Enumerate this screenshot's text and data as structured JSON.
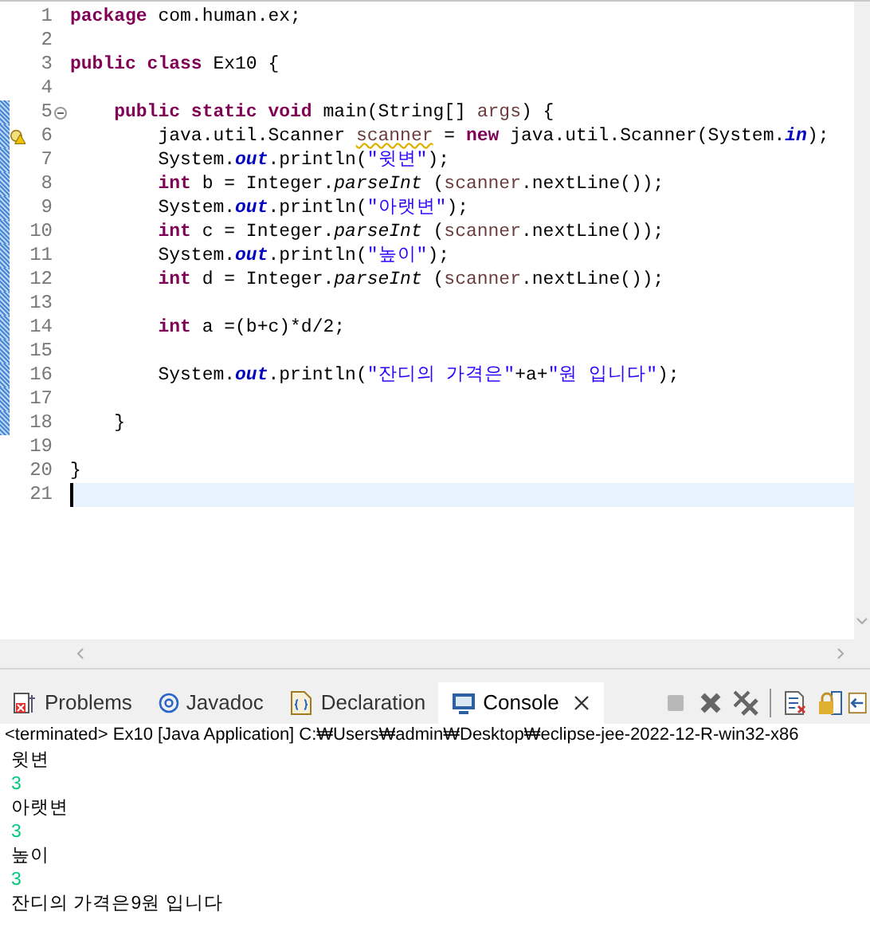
{
  "editor": {
    "lines": [
      {
        "number": "1",
        "changed": false,
        "fold": false,
        "warning": false,
        "current": false,
        "tokens": [
          {
            "kind": "kw",
            "text": "package"
          },
          {
            "kind": "plain",
            "text": " com.human.ex;"
          }
        ]
      },
      {
        "number": "2",
        "changed": false,
        "fold": false,
        "warning": false,
        "current": false
      },
      {
        "number": "3",
        "changed": false,
        "fold": false,
        "warning": false,
        "current": false,
        "tokens": [
          {
            "kind": "kw",
            "text": "public class"
          },
          {
            "kind": "plain",
            "text": " Ex10 {"
          }
        ]
      },
      {
        "number": "4",
        "changed": false,
        "fold": false,
        "warning": false,
        "current": false
      },
      {
        "number": "5",
        "changed": true,
        "fold": true,
        "warning": false,
        "current": false,
        "tokens": [
          {
            "kind": "kw",
            "text": "    public static void"
          },
          {
            "kind": "plain",
            "text": " main(String[] "
          },
          {
            "kind": "local",
            "text": "args"
          },
          {
            "kind": "plain",
            "text": ") {"
          }
        ]
      },
      {
        "number": "6",
        "changed": true,
        "fold": false,
        "warning": true,
        "current": false,
        "tokens": [
          {
            "kind": "plain",
            "text": "        java.util.Scanner "
          },
          {
            "kind": "warnlocal",
            "text": "scanner"
          },
          {
            "kind": "plain",
            "text": " = "
          },
          {
            "kind": "kw",
            "text": "new"
          },
          {
            "kind": "plain",
            "text": " java.util.Scanner(System."
          },
          {
            "kind": "field",
            "text": "in"
          },
          {
            "kind": "plain",
            "text": ");"
          }
        ]
      },
      {
        "number": "7",
        "changed": true,
        "fold": false,
        "warning": false,
        "current": false,
        "tokens": [
          {
            "kind": "plain",
            "text": "        System."
          },
          {
            "kind": "field",
            "text": "out"
          },
          {
            "kind": "plain",
            "text": ".println("
          },
          {
            "kind": "str",
            "text": "\"윗변\""
          },
          {
            "kind": "plain",
            "text": ");"
          }
        ]
      },
      {
        "number": "8",
        "changed": true,
        "fold": false,
        "warning": false,
        "current": false,
        "tokens": [
          {
            "kind": "kw",
            "text": "        int"
          },
          {
            "kind": "plain",
            "text": " b = Integer."
          },
          {
            "kind": "method",
            "text": "parseInt"
          },
          {
            "kind": "plain",
            "text": " ("
          },
          {
            "kind": "local",
            "text": "scanner"
          },
          {
            "kind": "plain",
            "text": ".nextLine());"
          }
        ]
      },
      {
        "number": "9",
        "changed": true,
        "fold": false,
        "warning": false,
        "current": false,
        "tokens": [
          {
            "kind": "plain",
            "text": "        System."
          },
          {
            "kind": "field",
            "text": "out"
          },
          {
            "kind": "plain",
            "text": ".println("
          },
          {
            "kind": "str",
            "text": "\"아랫변\""
          },
          {
            "kind": "plain",
            "text": ");"
          }
        ]
      },
      {
        "number": "10",
        "changed": true,
        "fold": false,
        "warning": false,
        "current": false,
        "tokens": [
          {
            "kind": "kw",
            "text": "        int"
          },
          {
            "kind": "plain",
            "text": " c = Integer."
          },
          {
            "kind": "method",
            "text": "parseInt"
          },
          {
            "kind": "plain",
            "text": " ("
          },
          {
            "kind": "local",
            "text": "scanner"
          },
          {
            "kind": "plain",
            "text": ".nextLine());"
          }
        ]
      },
      {
        "number": "11",
        "changed": true,
        "fold": false,
        "warning": false,
        "current": false,
        "tokens": [
          {
            "kind": "plain",
            "text": "        System."
          },
          {
            "kind": "field",
            "text": "out"
          },
          {
            "kind": "plain",
            "text": ".println("
          },
          {
            "kind": "str",
            "text": "\"높이\""
          },
          {
            "kind": "plain",
            "text": ");"
          }
        ]
      },
      {
        "number": "12",
        "changed": true,
        "fold": false,
        "warning": false,
        "current": false,
        "tokens": [
          {
            "kind": "kw",
            "text": "        int"
          },
          {
            "kind": "plain",
            "text": " d = Integer."
          },
          {
            "kind": "method",
            "text": "parseInt"
          },
          {
            "kind": "plain",
            "text": " ("
          },
          {
            "kind": "local",
            "text": "scanner"
          },
          {
            "kind": "plain",
            "text": ".nextLine());"
          }
        ]
      },
      {
        "number": "13",
        "changed": true,
        "fold": false,
        "warning": false,
        "current": false
      },
      {
        "number": "14",
        "changed": true,
        "fold": false,
        "warning": false,
        "current": false,
        "tokens": [
          {
            "kind": "kw",
            "text": "        int"
          },
          {
            "kind": "plain",
            "text": " a =(b+c)*d/2;"
          }
        ]
      },
      {
        "number": "15",
        "changed": true,
        "fold": false,
        "warning": false,
        "current": false
      },
      {
        "number": "16",
        "changed": true,
        "fold": false,
        "warning": false,
        "current": false,
        "tokens": [
          {
            "kind": "plain",
            "text": "        System."
          },
          {
            "kind": "field",
            "text": "out"
          },
          {
            "kind": "plain",
            "text": ".println("
          },
          {
            "kind": "str",
            "text": "\"잔디의 가격은\""
          },
          {
            "kind": "plain",
            "text": "+a+"
          },
          {
            "kind": "str",
            "text": "\"원 입니다\""
          },
          {
            "kind": "plain",
            "text": ");"
          }
        ]
      },
      {
        "number": "17",
        "changed": true,
        "fold": false,
        "warning": false,
        "current": false
      },
      {
        "number": "18",
        "changed": true,
        "fold": false,
        "warning": false,
        "current": false,
        "tokens": [
          {
            "kind": "plain",
            "text": "    }"
          }
        ]
      },
      {
        "number": "19",
        "changed": false,
        "fold": false,
        "warning": false,
        "current": false
      },
      {
        "number": "20",
        "changed": false,
        "fold": false,
        "warning": false,
        "current": false,
        "tokens": [
          {
            "kind": "plain",
            "text": "}"
          }
        ]
      },
      {
        "number": "21",
        "changed": false,
        "fold": false,
        "warning": false,
        "current": true
      }
    ]
  },
  "panel": {
    "tabs": [
      {
        "label": "Problems",
        "selected": false,
        "closable": false
      },
      {
        "label": "Javadoc",
        "selected": false,
        "closable": false
      },
      {
        "label": "Declaration",
        "selected": false,
        "closable": false
      },
      {
        "label": "Console",
        "selected": true,
        "closable": true
      }
    ],
    "toolbar": [
      {
        "kind": "stop",
        "disabled": true
      },
      {
        "kind": "remove",
        "disabled": false
      },
      {
        "kind": "remove-all",
        "disabled": false
      },
      {
        "kind": "separator"
      },
      {
        "kind": "clear",
        "disabled": false
      },
      {
        "kind": "lock",
        "disabled": false
      },
      {
        "kind": "pin",
        "disabled": false
      }
    ],
    "console_header": "<terminated> Ex10 [Java Application] C:₩Users₩admin₩Desktop₩eclipse-jee-2022-12-R-win32-x86",
    "output": [
      {
        "kind": "out",
        "text": "윗변"
      },
      {
        "kind": "in",
        "text": "3"
      },
      {
        "kind": "out",
        "text": "아랫변"
      },
      {
        "kind": "in",
        "text": "3"
      },
      {
        "kind": "out",
        "text": "높이"
      },
      {
        "kind": "in",
        "text": "3"
      },
      {
        "kind": "out",
        "text": "잔디의 가격은9원 입니다"
      }
    ]
  }
}
